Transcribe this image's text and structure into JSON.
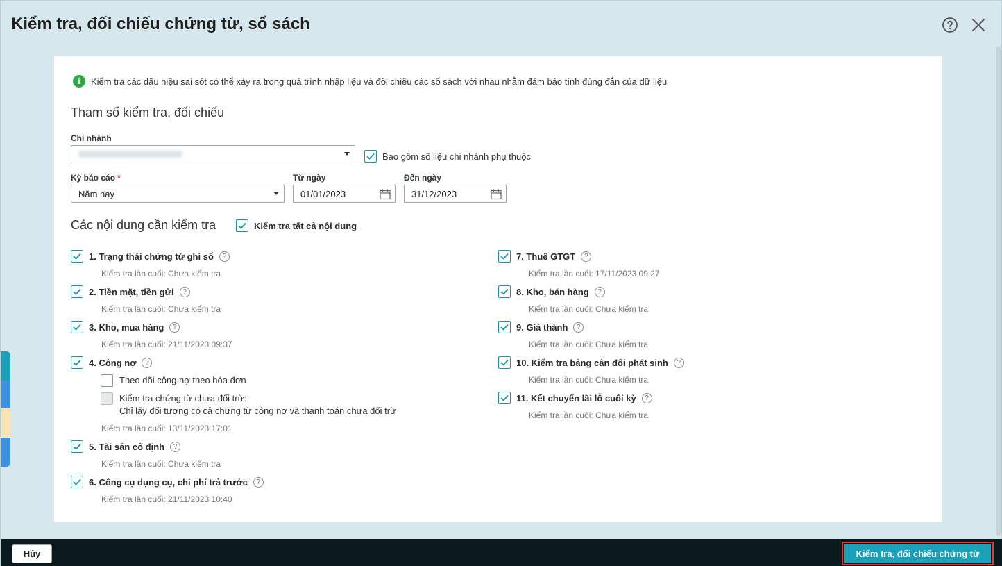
{
  "dialog": {
    "title": "Kiểm tra, đối chiếu chứng từ, sổ sách"
  },
  "info": "Kiểm tra các dấu hiệu sai sót có thể xảy ra trong quá trình nhập liệu và đối chiếu các sổ sách với nhau nhằm đảm bảo tính đúng đắn của dữ liệu",
  "params": {
    "section_title": "Tham số kiểm tra, đối chiếu",
    "branch_label": "Chi nhánh",
    "branch_value": "",
    "include_dependent_label": "Bao gồm số liệu chi nhánh phụ thuộc",
    "include_dependent_checked": true,
    "period_label": "Kỳ báo cáo",
    "period_required": "*",
    "period_value": "Năm nay",
    "from_label": "Từ ngày",
    "from_value": "01/01/2023",
    "to_label": "Đến ngày",
    "to_value": "31/12/2023"
  },
  "contents": {
    "section_title": "Các nội dung cần kiểm tra",
    "check_all_label": "Kiểm tra tất cả nội dung",
    "check_all_checked": true,
    "left_items": [
      {
        "label": "1. Trạng thái chứng từ ghi sổ",
        "checked": true,
        "last": "Kiểm tra lần cuối: Chưa kiểm tra"
      },
      {
        "label": "2. Tiền mặt, tiền gửi",
        "checked": true,
        "last": "Kiểm tra lần cuối: Chưa kiểm tra"
      },
      {
        "label": "3. Kho, mua hàng",
        "checked": true,
        "last": "Kiểm tra lần cuối: 21/11/2023 09:37"
      },
      {
        "label": "4. Công nợ",
        "checked": true,
        "last": "Kiểm tra lần cuối: 13/11/2023 17:01"
      },
      {
        "label": "5. Tài sản cố định",
        "checked": true,
        "last": "Kiểm tra lần cuối: Chưa kiểm tra"
      },
      {
        "label": "6. Công cụ dụng cụ, chi phí trả trước",
        "checked": true,
        "last": "Kiểm tra lần cuối: 21/11/2023 10:40"
      }
    ],
    "debt_options": {
      "track_by_invoice": "Theo dõi công nợ theo hóa đơn",
      "uncleared_line1": "Kiểm tra chứng từ chưa đối trừ:",
      "uncleared_line2": "Chỉ lấy đối tượng có cả chứng từ công nợ và thanh toán chưa đối trừ"
    },
    "right_items": [
      {
        "label": "7. Thuế GTGT",
        "checked": true,
        "last": "Kiểm tra lần cuối: 17/11/2023 09:27"
      },
      {
        "label": "8. Kho, bán hàng",
        "checked": true,
        "last": "Kiểm tra lần cuối: Chưa kiểm tra"
      },
      {
        "label": "9. Giá thành",
        "checked": true,
        "last": "Kiểm tra lần cuối: Chưa kiểm tra"
      },
      {
        "label": "10. Kiểm tra bảng cân đối phát sinh",
        "checked": true,
        "last": "Kiểm tra lần cuối: Chưa kiểm tra"
      },
      {
        "label": "11. Kết chuyển lãi lỗ cuối kỳ",
        "checked": true,
        "last": "Kiểm tra lần cuối: Chưa kiểm tra"
      }
    ]
  },
  "footer": {
    "cancel_label": "Hủy",
    "submit_label": "Kiểm tra, đối chiếu chứng từ"
  },
  "colors": {
    "accent": "#1aa0b8",
    "dialog_bg": "#d6e8ed",
    "footer_bg": "#0a1a1c",
    "highlight_border": "#e03b3b"
  }
}
